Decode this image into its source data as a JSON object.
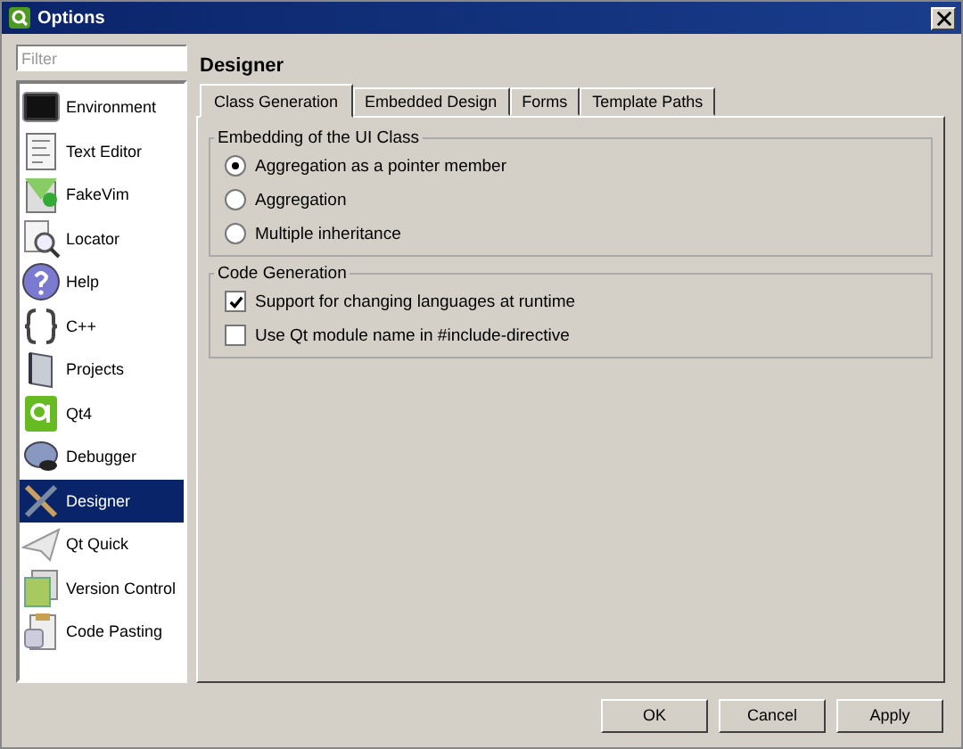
{
  "window": {
    "title": "Options"
  },
  "filter": {
    "placeholder": "Filter"
  },
  "sidebar": {
    "items": [
      {
        "label": "Environment",
        "selected": false
      },
      {
        "label": "Text Editor",
        "selected": false
      },
      {
        "label": "FakeVim",
        "selected": false
      },
      {
        "label": "Locator",
        "selected": false
      },
      {
        "label": "Help",
        "selected": false
      },
      {
        "label": "C++",
        "selected": false
      },
      {
        "label": "Projects",
        "selected": false
      },
      {
        "label": "Qt4",
        "selected": false
      },
      {
        "label": "Debugger",
        "selected": false
      },
      {
        "label": "Designer",
        "selected": true
      },
      {
        "label": "Qt Quick",
        "selected": false
      },
      {
        "label": "Version Control",
        "selected": false
      },
      {
        "label": "Code Pasting",
        "selected": false
      }
    ]
  },
  "page": {
    "title": "Designer",
    "tabs": [
      {
        "label": "Class Generation",
        "selected": true
      },
      {
        "label": "Embedded Design",
        "selected": false
      },
      {
        "label": "Forms",
        "selected": false
      },
      {
        "label": "Template Paths",
        "selected": false
      }
    ],
    "groups": [
      {
        "title": "Embedding of the UI Class",
        "options": [
          {
            "kind": "radio",
            "label": "Aggregation as a pointer member",
            "checked": true
          },
          {
            "kind": "radio",
            "label": "Aggregation",
            "checked": false
          },
          {
            "kind": "radio",
            "label": "Multiple inheritance",
            "checked": false
          }
        ]
      },
      {
        "title": "Code Generation",
        "options": [
          {
            "kind": "checkbox",
            "label": "Support for changing languages at runtime",
            "checked": true
          },
          {
            "kind": "checkbox",
            "label": "Use Qt module name in #include-directive",
            "checked": false
          }
        ]
      }
    ]
  },
  "buttons": [
    "OK",
    "Cancel",
    "Apply"
  ]
}
